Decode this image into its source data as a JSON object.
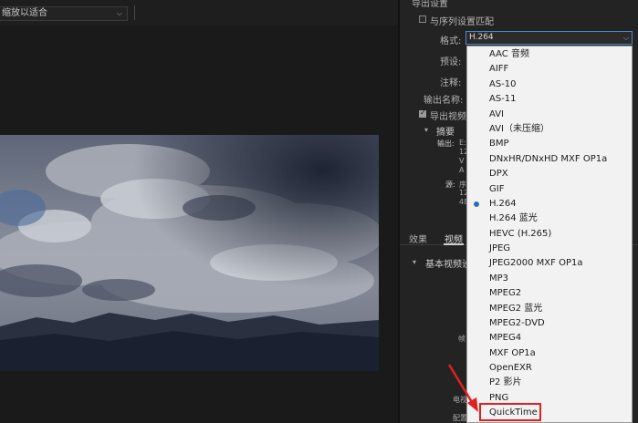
{
  "preview": {
    "fit_label": "缩放以适合"
  },
  "export_settings": {
    "section_title": "导出设置",
    "match_sequence_label": "与序列设置匹配",
    "format_label": "格式:",
    "format_value": "H.264",
    "preset_label": "预设:",
    "comments_label": "注释:",
    "output_name_label": "输出名称:",
    "export_video_label": "导出视频",
    "summary_label": "摘要",
    "output_label": "输出:",
    "output_fragments": [
      "E:",
      "12",
      "V",
      "A"
    ],
    "source_label": "源:",
    "source_fragments": [
      "序",
      "12",
      "48"
    ]
  },
  "tabs": {
    "effects": "效果",
    "video": "视频"
  },
  "basic_video_settings": "基本视频设",
  "side_fragments": {
    "frame": "帧",
    "tv": "电视",
    "config": "配置"
  },
  "format_options": [
    "AAC 音频",
    "AIFF",
    "AS-10",
    "AS-11",
    "AVI",
    "AVI（未压缩）",
    "BMP",
    "DNxHR/DNxHD MXF OP1a",
    "DPX",
    "GIF",
    "H.264",
    "H.264 蓝光",
    "HEVC (H.265)",
    "JPEG",
    "JPEG2000 MXF OP1a",
    "MP3",
    "MPEG2",
    "MPEG2 蓝光",
    "MPEG2-DVD",
    "MPEG4",
    "MXF OP1a",
    "OpenEXR",
    "P2 影片",
    "PNG",
    "QuickTime"
  ],
  "selected_format": "H.264",
  "highlighted_format": "QuickTime",
  "colors": {
    "accent_blue": "#4c88c9",
    "highlight_red": "#e02020"
  }
}
